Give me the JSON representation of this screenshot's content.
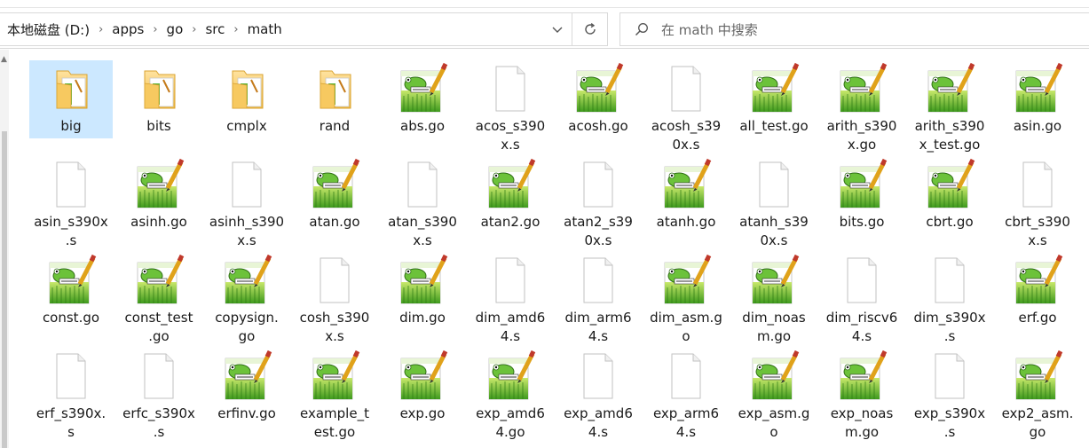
{
  "breadcrumbs": [
    "本地磁盘 (D:)",
    "apps",
    "go",
    "src",
    "math"
  ],
  "search": {
    "placeholder": "在 math 中搜索"
  },
  "colors": {
    "selection": "#cce8ff",
    "folder": "#f5c24c",
    "border": "#d9d9d9"
  },
  "items": [
    {
      "label": "big",
      "type": "folder",
      "selected": true
    },
    {
      "label": "bits",
      "type": "folder"
    },
    {
      "label": "cmplx",
      "type": "folder"
    },
    {
      "label": "rand",
      "type": "folder"
    },
    {
      "label": "abs.go",
      "type": "npp"
    },
    {
      "label": "acos_s390\nx.s",
      "type": "blank"
    },
    {
      "label": "acosh.go",
      "type": "npp"
    },
    {
      "label": "acosh_s39\n0x.s",
      "type": "blank"
    },
    {
      "label": "all_test.go",
      "type": "npp"
    },
    {
      "label": "arith_s390\nx.go",
      "type": "npp"
    },
    {
      "label": "arith_s390\nx_test.go",
      "type": "npp"
    },
    {
      "label": "asin.go",
      "type": "npp"
    },
    {
      "label": "asin_s390x\n.s",
      "type": "blank"
    },
    {
      "label": "asinh.go",
      "type": "npp"
    },
    {
      "label": "asinh_s390\nx.s",
      "type": "blank"
    },
    {
      "label": "atan.go",
      "type": "npp"
    },
    {
      "label": "atan_s390\nx.s",
      "type": "blank"
    },
    {
      "label": "atan2.go",
      "type": "npp"
    },
    {
      "label": "atan2_s39\n0x.s",
      "type": "blank"
    },
    {
      "label": "atanh.go",
      "type": "npp"
    },
    {
      "label": "atanh_s39\n0x.s",
      "type": "blank"
    },
    {
      "label": "bits.go",
      "type": "npp"
    },
    {
      "label": "cbrt.go",
      "type": "npp"
    },
    {
      "label": "cbrt_s390\nx.s",
      "type": "blank"
    },
    {
      "label": "const.go",
      "type": "npp"
    },
    {
      "label": "const_test\n.go",
      "type": "npp"
    },
    {
      "label": "copysign.\ngo",
      "type": "npp"
    },
    {
      "label": "cosh_s390\nx.s",
      "type": "blank"
    },
    {
      "label": "dim.go",
      "type": "npp"
    },
    {
      "label": "dim_amd6\n4.s",
      "type": "blank"
    },
    {
      "label": "dim_arm6\n4.s",
      "type": "blank"
    },
    {
      "label": "dim_asm.g\no",
      "type": "npp"
    },
    {
      "label": "dim_noas\nm.go",
      "type": "npp"
    },
    {
      "label": "dim_riscv6\n4.s",
      "type": "blank"
    },
    {
      "label": "dim_s390x\n.s",
      "type": "blank"
    },
    {
      "label": "erf.go",
      "type": "npp"
    },
    {
      "label": "erf_s390x.\ns",
      "type": "blank"
    },
    {
      "label": "erfc_s390x\n.s",
      "type": "blank"
    },
    {
      "label": "erfinv.go",
      "type": "npp"
    },
    {
      "label": "example_t\nest.go",
      "type": "npp"
    },
    {
      "label": "exp.go",
      "type": "npp"
    },
    {
      "label": "exp_amd6\n4.go",
      "type": "npp"
    },
    {
      "label": "exp_amd6\n4.s",
      "type": "blank"
    },
    {
      "label": "exp_arm6\n4.s",
      "type": "blank"
    },
    {
      "label": "exp_asm.g\no",
      "type": "npp"
    },
    {
      "label": "exp_noas\nm.go",
      "type": "npp"
    },
    {
      "label": "exp_s390x\n.s",
      "type": "blank"
    },
    {
      "label": "exp2_asm.\ngo",
      "type": "npp"
    }
  ]
}
